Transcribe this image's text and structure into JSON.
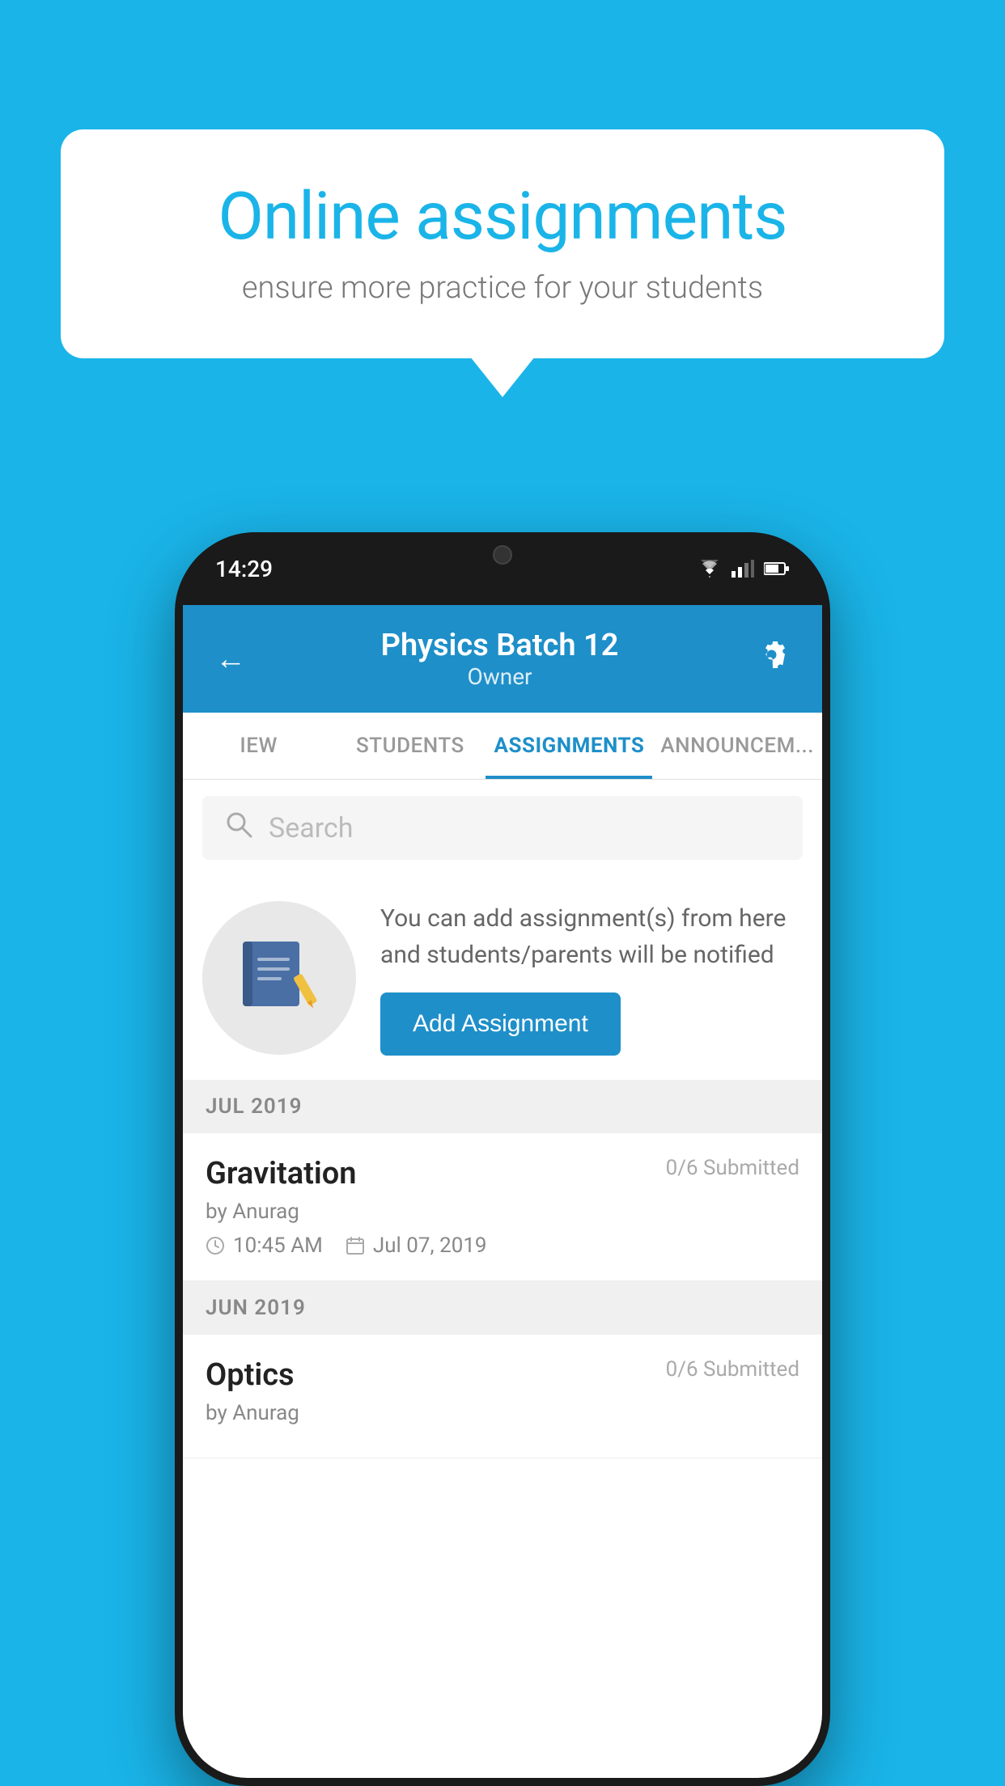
{
  "background_color": "#1ab4e8",
  "speech_bubble": {
    "title": "Online assignments",
    "subtitle": "ensure more practice for your students"
  },
  "phone": {
    "status_bar": {
      "time": "14:29"
    },
    "header": {
      "title": "Physics Batch 12",
      "subtitle": "Owner",
      "back_label": "←",
      "settings_label": "⚙"
    },
    "tabs": [
      {
        "label": "IEW",
        "active": false
      },
      {
        "label": "STUDENTS",
        "active": false
      },
      {
        "label": "ASSIGNMENTS",
        "active": true
      },
      {
        "label": "ANNOUNCEM...",
        "active": false
      }
    ],
    "search": {
      "placeholder": "Search"
    },
    "info_card": {
      "description": "You can add assignment(s) from here and students/parents will be notified",
      "button_label": "Add Assignment"
    },
    "sections": [
      {
        "label": "JUL 2019",
        "assignments": [
          {
            "name": "Gravitation",
            "submitted": "0/6 Submitted",
            "by": "by Anurag",
            "time": "10:45 AM",
            "date": "Jul 07, 2019"
          }
        ]
      },
      {
        "label": "JUN 2019",
        "assignments": [
          {
            "name": "Optics",
            "submitted": "0/6 Submitted",
            "by": "by Anurag",
            "time": "",
            "date": ""
          }
        ]
      }
    ]
  }
}
